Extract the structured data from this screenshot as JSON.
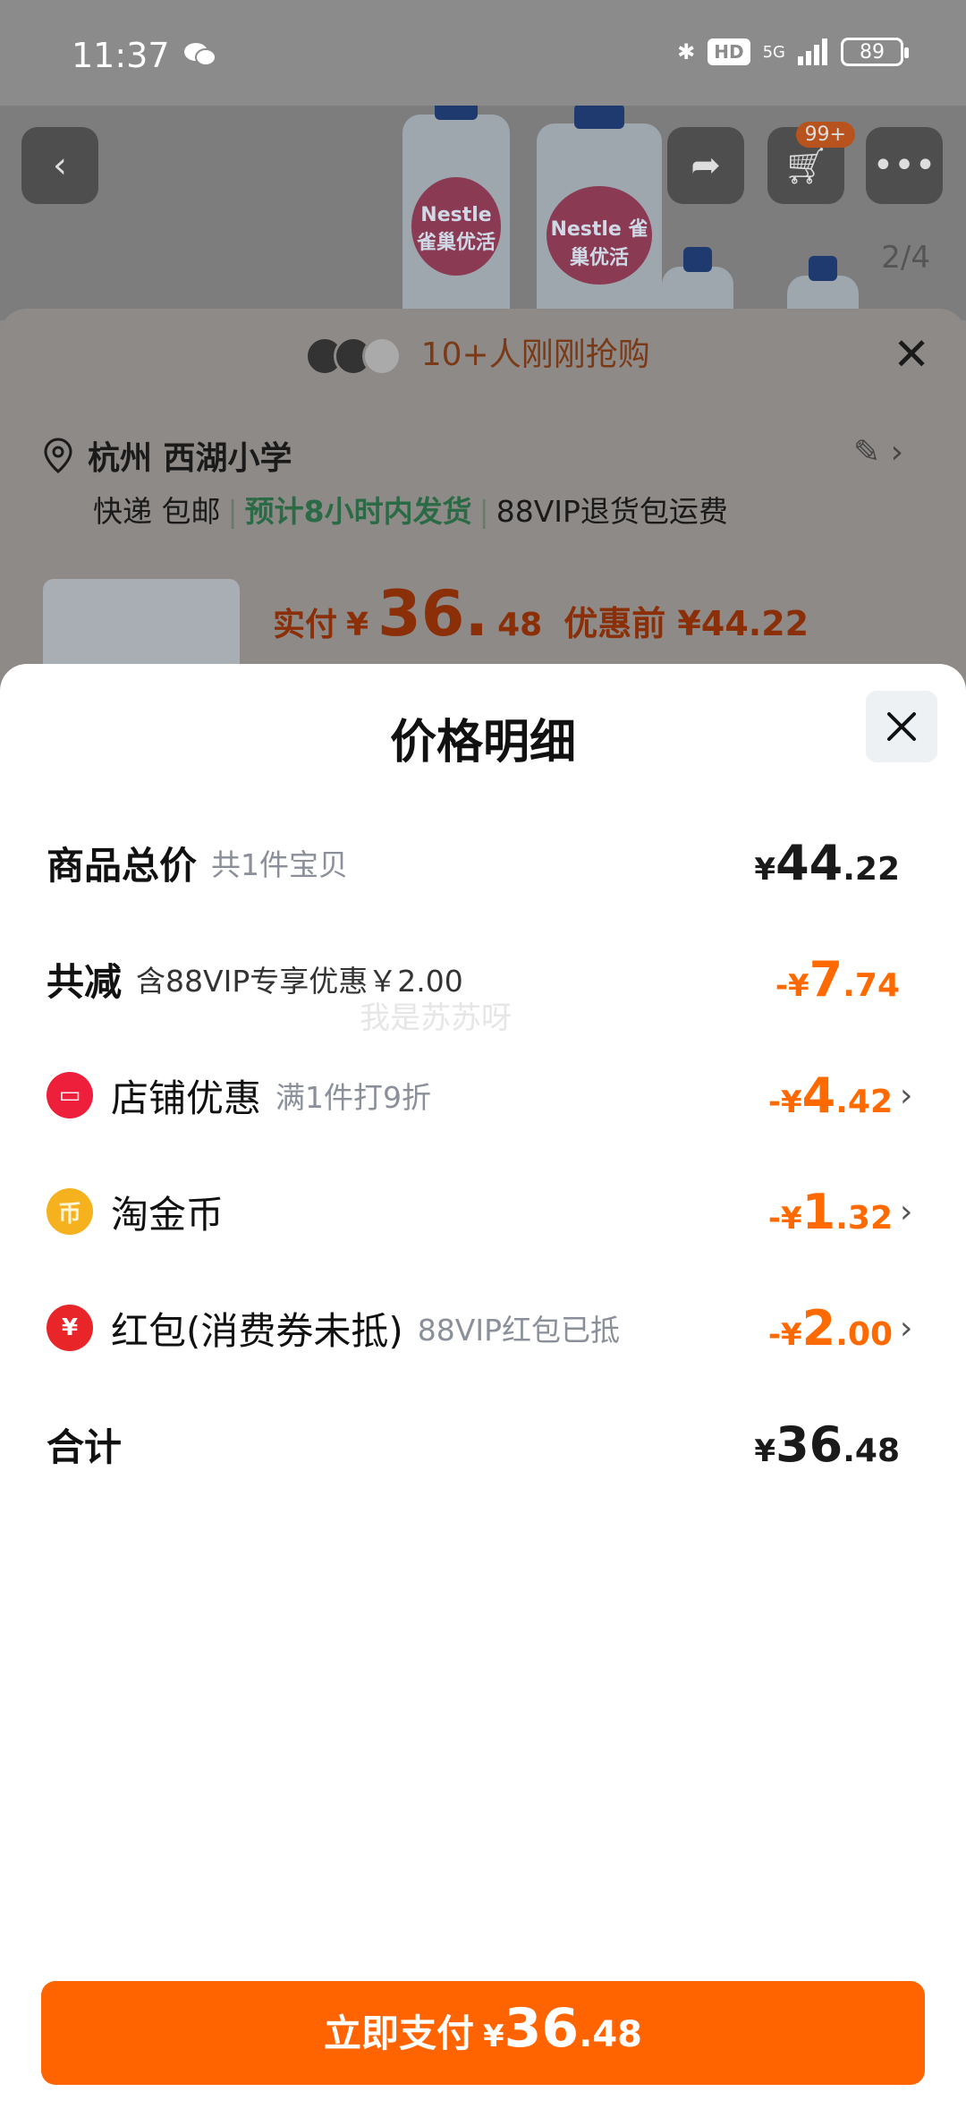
{
  "status_bar": {
    "time": "11:37",
    "network": "5G",
    "hd": "HD",
    "battery": "89"
  },
  "hero": {
    "page_indicator": "2/4",
    "cart_badge": "99+",
    "brand_text": "Nestle 雀巢优活"
  },
  "bg_sheet": {
    "buyers_text": "10+人刚刚抢购",
    "location": "杭州 西湖小学",
    "shipping_method": "快递 包邮",
    "ship_time": "预计8小时内发货",
    "return_policy": "88VIP退货包运费",
    "pay_label": "实付",
    "currency": "¥",
    "pay_int": "36.",
    "pay_dec": "48",
    "pre_label": "优惠前 ¥44.22"
  },
  "modal": {
    "title": "价格明细",
    "rows": [
      {
        "name": "商品总价",
        "sub": "共1件宝贝",
        "cur": "¥",
        "int": "44",
        "dec": ".22"
      },
      {
        "name": "共减",
        "sub": "含88VIP专享优惠￥2.00",
        "cur": "-¥",
        "int": "7",
        "dec": ".74"
      },
      {
        "name": "店铺优惠",
        "sub": "满1件打9折",
        "cur": "-¥",
        "int": "4",
        "dec": ".42"
      },
      {
        "name": "淘金币",
        "sub": "",
        "cur": "-¥",
        "int": "1",
        "dec": ".32"
      },
      {
        "name": "红包(消费券未抵)",
        "sub": "88VIP红包已抵",
        "cur": "-¥",
        "int": "2",
        "dec": ".00"
      },
      {
        "name": "合计",
        "sub": "",
        "cur": "¥",
        "int": "36",
        "dec": ".48"
      }
    ],
    "watermark": "我是苏苏呀"
  },
  "pay_button": {
    "label": "立即支付",
    "cur": "¥",
    "int": "36",
    "dec": ".48"
  },
  "colors": {
    "accent": "#ff6400",
    "discount": "#ff6a00"
  }
}
